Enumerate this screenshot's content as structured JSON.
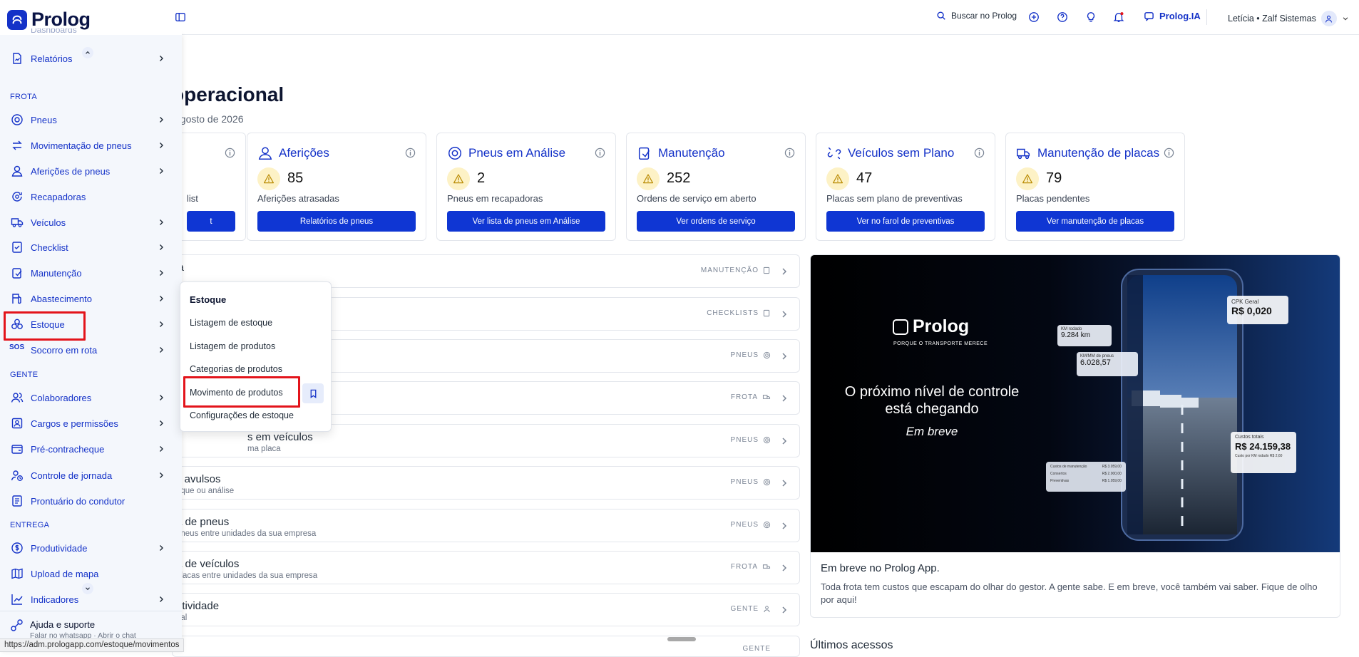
{
  "topbar": {
    "search_label": "Buscar no Prolog",
    "ia_label": "Prolog.IA",
    "user_label": "Letícia • Zalf Sistemas"
  },
  "brand": {
    "name": "Prolog",
    "accent": "#1432c8",
    "button": "#0f36d3",
    "highlight": "#e3141b"
  },
  "page": {
    "title": "operacional",
    "subtitle": "agosto de 2026",
    "section": "ta"
  },
  "cards": [
    {
      "title": "",
      "value": "",
      "label": "list",
      "button": "t",
      "icon": "list-icon"
    },
    {
      "title": "Aferições",
      "value": "85",
      "label": "Aferições atrasadas",
      "button": "Relatórios de pneus",
      "icon": "user-gauge-icon"
    },
    {
      "title": "Pneus em Análise",
      "value": "2",
      "label": "Pneus em recapadoras",
      "button": "Ver lista de pneus em Análise",
      "icon": "tire-icon"
    },
    {
      "title": "Manutenção",
      "value": "252",
      "label": "Ordens de serviço em aberto",
      "button": "Ver ordens de serviço",
      "icon": "wrench-icon"
    },
    {
      "title": "Veículos sem Plano",
      "value": "47",
      "label": "Placas sem plano de preventivas",
      "button": "Ver no farol de preventivas",
      "icon": "broken-link-icon"
    },
    {
      "title": "Manutenção de placas",
      "value": "79",
      "label": "Placas pendentes",
      "button": "Ver manutenção de placas",
      "icon": "truck-wrench-icon"
    }
  ],
  "rows": [
    {
      "title": "sa",
      "subtitle": "",
      "tag": "MANUTENÇÃO",
      "icon": "wrench-icon"
    },
    {
      "title": "",
      "subtitle": "",
      "tag": "CHECKLISTS",
      "icon": "checklist-icon"
    },
    {
      "title": "",
      "subtitle": "",
      "tag": "PNEUS",
      "icon": "tire-icon"
    },
    {
      "title": "",
      "subtitle": "",
      "tag": "FROTA",
      "icon": "truck-icon"
    },
    {
      "title": "s em veículos",
      "subtitle": "ma placa",
      "tag": "PNEUS",
      "icon": "tire-icon"
    },
    {
      "title": "s avulsos",
      "subtitle": "oque ou análise",
      "tag": "PNEUS",
      "icon": "tire-icon"
    },
    {
      "title": "a de pneus",
      "subtitle": "pneus entre unidades da sua empresa",
      "tag": "PNEUS",
      "icon": "tire-icon"
    },
    {
      "title": "a de veículos",
      "subtitle": "placas entre unidades da sua empresa",
      "tag": "FROTA",
      "icon": "truck-icon"
    },
    {
      "title": "utividade",
      "subtitle": "ual",
      "tag": "GENTE",
      "icon": "person-icon"
    },
    {
      "title": "",
      "subtitle": "",
      "tag": "GENTE",
      "icon": "person-icon"
    }
  ],
  "promo": {
    "logo_text": "Prolog",
    "logo_sub": "PORQUE O TRANSPORTE MERECE",
    "headline_1": "O próximo nível de controle",
    "headline_2": "está chegando",
    "soon": "Em breve",
    "cpk_label": "CPK Geral",
    "cpk_value": "R$ 0,020",
    "km_label": "KM rodado",
    "km_value": "9.284 km",
    "kmmm_label": "KM/MM de pneus",
    "kmmm_value": "6.028,57",
    "cost_label": "Custos totais",
    "cost_value": "R$ 24.159,38",
    "cost_sub": "Custo por KM rodado",
    "cost_sub_value": "R$ 2,60",
    "maint_label": "Custos de manutenção",
    "maint_value": "R$ 3.059,00",
    "maint_r1": "Consertos",
    "maint_r1_value": "R$ 2.000,00",
    "maint_r2": "Preventivas",
    "maint_r2_value": "R$ 1.059,00",
    "title": "Em breve no Prolog App.",
    "text": "Toda frota tem custos que escapam do olhar do gestor. A gente sabe. E em breve, você também vai saber. Fique de olho por aqui!"
  },
  "recent_title": "Últimos acessos",
  "sidebar": {
    "partial_top": "Dashboards",
    "relatorios": "Relatórios",
    "group_frota": "FROTA",
    "group_gente": "GENTE",
    "group_entrega": "ENTREGA",
    "items": [
      {
        "label": "Pneus",
        "icon": "tire-icon"
      },
      {
        "label": "Movimentação de pneus",
        "icon": "swap-arrows-icon"
      },
      {
        "label": "Aferições de pneus",
        "icon": "user-gauge-icon"
      },
      {
        "label": "Recapadoras",
        "icon": "recycle-tire-icon"
      },
      {
        "label": "Veículos",
        "icon": "truck-icon"
      },
      {
        "label": "Checklist",
        "icon": "checklist-icon"
      },
      {
        "label": "Manutenção",
        "icon": "wrench-icon"
      },
      {
        "label": "Abastecimento",
        "icon": "fuel-pump-icon"
      },
      {
        "label": "Estoque",
        "icon": "boxes-icon"
      },
      {
        "label": "Socorro em rota",
        "icon": "sos-icon"
      },
      {
        "label": "Colaboradores",
        "icon": "users-icon"
      },
      {
        "label": "Cargos e permissões",
        "icon": "id-badge-icon"
      },
      {
        "label": "Pré-contracheque",
        "icon": "wallet-icon"
      },
      {
        "label": "Controle de jornada",
        "icon": "user-clock-icon"
      },
      {
        "label": "Prontuário do condutor",
        "icon": "document-list-icon"
      },
      {
        "label": "Produtividade",
        "icon": "dollar-circle-icon"
      },
      {
        "label": "Upload de mapa",
        "icon": "map-icon"
      },
      {
        "label": "Indicadores",
        "icon": "chart-line-icon"
      }
    ],
    "help_title": "Ajuda e suporte",
    "help_sub": "Falar no whatsapp · Abrir o chat"
  },
  "flyout": {
    "header": "Estoque",
    "items": [
      "Listagem de estoque",
      "Listagem de produtos",
      "Categorias de produtos",
      "Movimento de produtos",
      "Configurações de estoque"
    ]
  },
  "status_url": "https://adm.prologapp.com/estoque/movimentos"
}
